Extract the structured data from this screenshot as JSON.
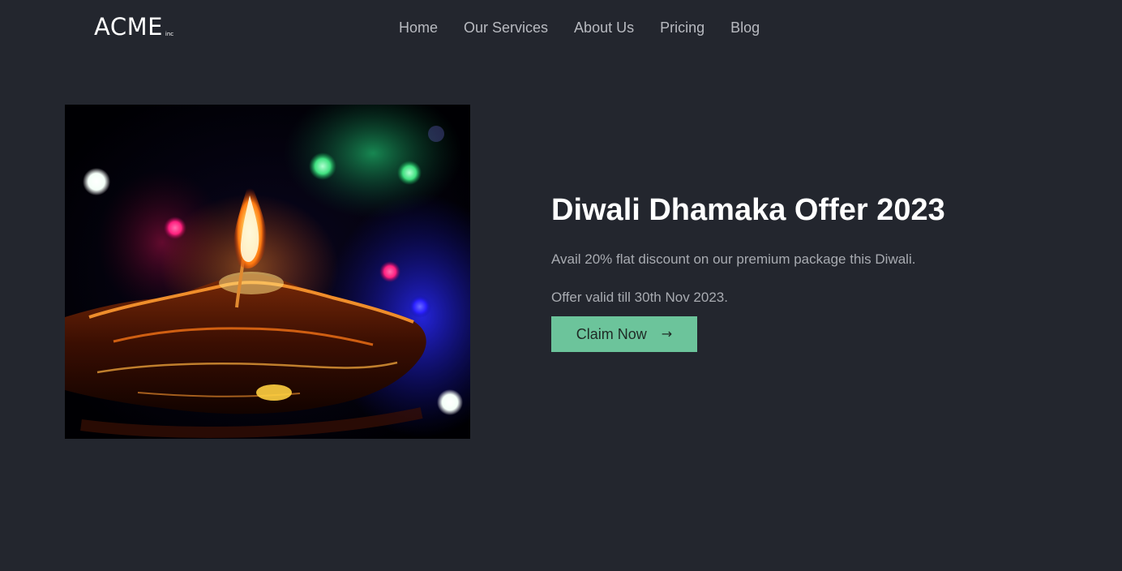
{
  "brand": {
    "name": "ACME",
    "suffix": "inc"
  },
  "nav": {
    "items": [
      {
        "label": "Home"
      },
      {
        "label": "Our Services"
      },
      {
        "label": "About Us"
      },
      {
        "label": "Pricing"
      },
      {
        "label": "Blog"
      }
    ]
  },
  "hero": {
    "image_icon": "diya-candle-image",
    "title": "Diwali Dhamaka Offer 2023",
    "description": "Avail 20% flat discount on our premium package this Diwali.",
    "validity": "Offer valid till 30th Nov 2023.",
    "cta_label": "Claim Now",
    "cta_icon": "arrow-right-icon"
  },
  "colors": {
    "background": "#23262e",
    "accent": "#6cc49b",
    "text_primary": "#ffffff",
    "text_muted": "#a8abb1"
  }
}
